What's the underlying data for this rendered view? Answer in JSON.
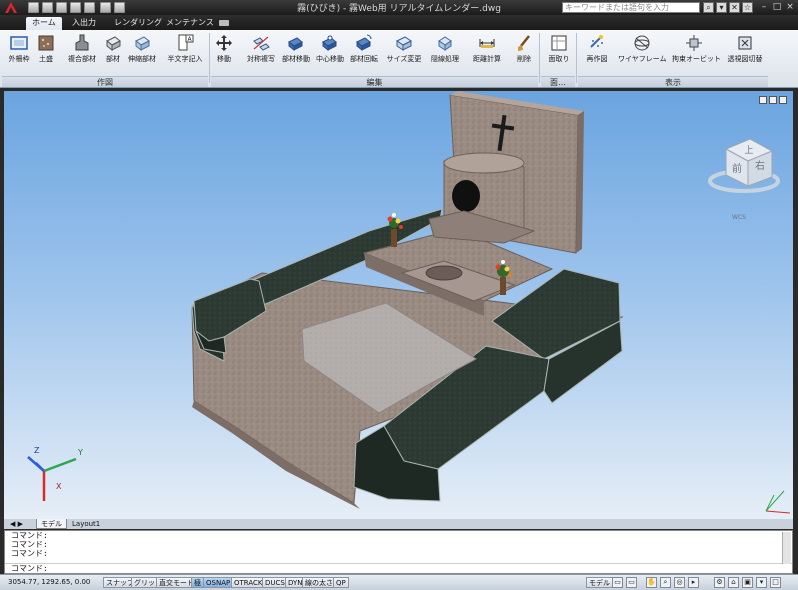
{
  "window": {
    "title": "霧(ひびき)  - 霧Web用 リアルタイムレンダー.dwg",
    "search_placeholder": "キーワードまたは語句を入力",
    "minimize": "–",
    "maximize": "□",
    "close": "×"
  },
  "tabs": [
    {
      "label": "ホーム"
    },
    {
      "label": "入出力"
    },
    {
      "label": "レンダリング"
    },
    {
      "label": "メンテナンス"
    }
  ],
  "ribbon": {
    "groups": {
      "sakuzu": "作図",
      "henshu": "編集",
      "men": "面…",
      "hyoji": "表示"
    },
    "buttons": {
      "sotogaki": "外柵枠",
      "dodai": "土盛",
      "fukugo": "複合部材",
      "buzai": "部材",
      "shinshuku": "伸縮部材",
      "hanmoji": "半文字記入",
      "ido": "移動",
      "taisho": "対称複写",
      "buzai_ido": "部材移動",
      "chushin": "中心移動",
      "kaiten": "部材回転",
      "size": "サイズ変更",
      "inshin": "隠線処理",
      "kyori": "距離計算",
      "sakujo": "削除",
      "menntori": "面取り",
      "saisakuzu": "再作図",
      "wireframe": "ワイヤフレーム",
      "orbit": "拘束オービット",
      "kirikae": "透視図切替"
    }
  },
  "viewport": {
    "viewcube": {
      "top": "上",
      "front": "前",
      "right": "右",
      "wcs": "WCS"
    },
    "axes": {
      "x": "X",
      "y": "Y",
      "z": "Z"
    }
  },
  "layout_tabs": {
    "model": "モデル",
    "layout1": "Layout1"
  },
  "command": {
    "history": [
      "コマンド:",
      "コマンド:",
      "コマンド:"
    ],
    "prompt": "コマンド:"
  },
  "status": {
    "coords": "3054.77,  1292.65, 0.00",
    "toggles": [
      "スナップ",
      "グリッド",
      "直交モード",
      "極",
      "OSNAP",
      "OTRACK",
      "DUCS",
      "DYN",
      "線の太さ",
      "QP"
    ],
    "model_label": "モデル"
  },
  "colors": {
    "granite": "#9a8b83",
    "dark_granite": "#2c3a33",
    "inner_floor": "#b3aeac",
    "sky_top": "#6aa4df",
    "sky_bottom": "#e6eef7"
  }
}
